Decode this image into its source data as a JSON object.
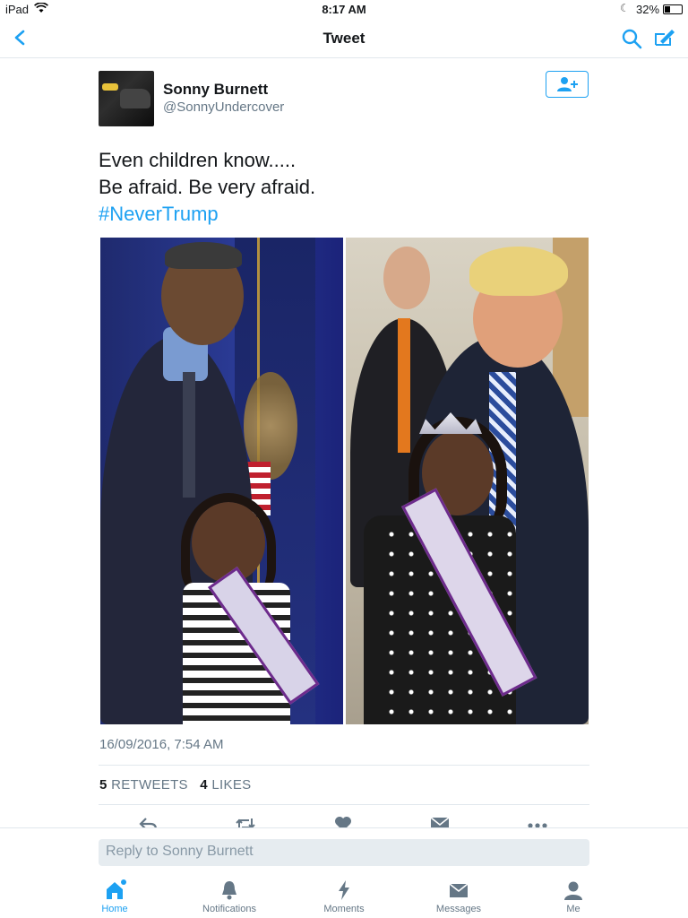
{
  "status_bar": {
    "device": "iPad",
    "time": "8:17 AM",
    "battery": "32%"
  },
  "nav": {
    "title": "Tweet",
    "back_icon": "chevron-left-icon",
    "search_icon": "search-icon",
    "compose_icon": "compose-icon"
  },
  "tweet": {
    "author_name": "Sonny Burnett",
    "author_handle": "@SonnyUndercover",
    "text_line1": "Even children know.....",
    "text_line2": "Be afraid. Be very afraid.",
    "hashtag": "#NeverTrump",
    "timestamp": "16/09/2016, 7:54 AM",
    "retweet_count": "5",
    "retweet_label": "RETWEETS",
    "like_count": "4",
    "like_label": "LIKES"
  },
  "reply": {
    "placeholder": "Reply to Sonny Burnett"
  },
  "tabs": [
    {
      "label": "Home",
      "icon": "home-icon",
      "active": true
    },
    {
      "label": "Notifications",
      "icon": "bell-icon",
      "active": false
    },
    {
      "label": "Moments",
      "icon": "lightning-icon",
      "active": false
    },
    {
      "label": "Messages",
      "icon": "envelope-icon",
      "active": false
    },
    {
      "label": "Me",
      "icon": "person-icon",
      "active": false
    }
  ],
  "colors": {
    "accent": "#1da1f2",
    "secondary_text": "#657786",
    "divider": "#e1e8ed"
  }
}
